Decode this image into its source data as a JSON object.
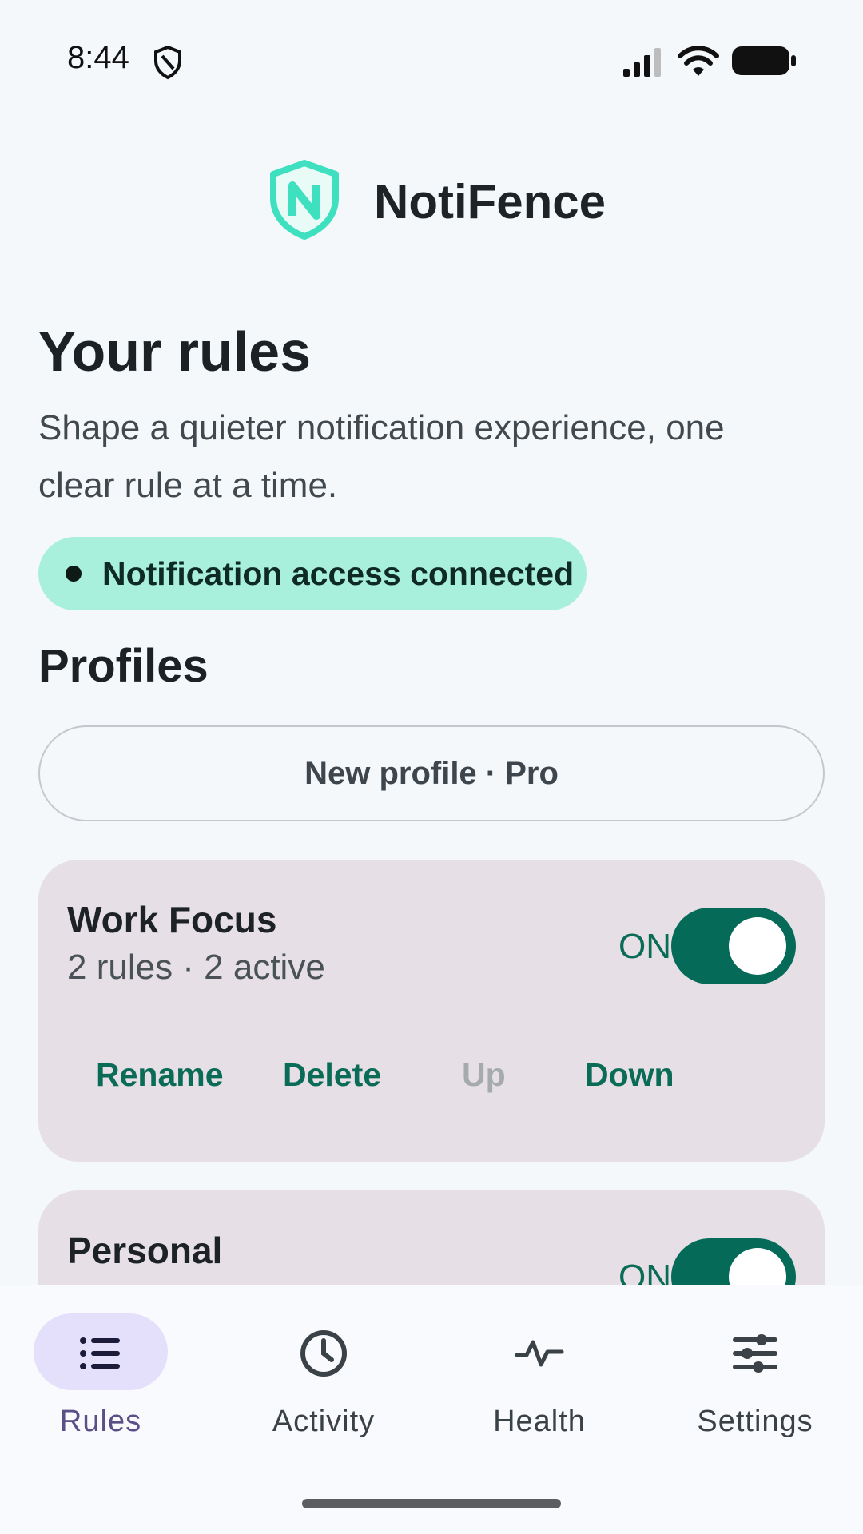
{
  "status_bar": {
    "time": "8:44"
  },
  "app": {
    "name": "NotiFence"
  },
  "page": {
    "title": "Your rules",
    "subtitle": "Shape a quieter notification experience, one clear rule at a time."
  },
  "access_chip": {
    "label": "Notification access connected"
  },
  "profiles_section": {
    "heading": "Profiles",
    "new_profile_label": "New profile · Pro",
    "items": [
      {
        "name": "Work Focus",
        "meta": "2 rules · 2 active",
        "toggle_label": "ON",
        "enabled": true,
        "actions": [
          "Rename",
          "Delete",
          "Up",
          "Down"
        ],
        "disabled_actions": [
          "Up"
        ]
      },
      {
        "name": "Personal",
        "toggle_label": "ON",
        "enabled": true
      }
    ]
  },
  "bottom_nav": {
    "items": [
      {
        "label": "Rules",
        "icon": "list-icon",
        "active": true
      },
      {
        "label": "Activity",
        "icon": "clock-icon",
        "active": false
      },
      {
        "label": "Health",
        "icon": "pulse-icon",
        "active": false
      },
      {
        "label": "Settings",
        "icon": "sliders-icon",
        "active": false
      }
    ]
  },
  "colors": {
    "accent": "#056b58",
    "chip_bg": "#a8f0dc",
    "card_bg": "#e6e0e6",
    "active_nav_pill": "#e4e0fb",
    "logo": "#3ee0c0"
  }
}
